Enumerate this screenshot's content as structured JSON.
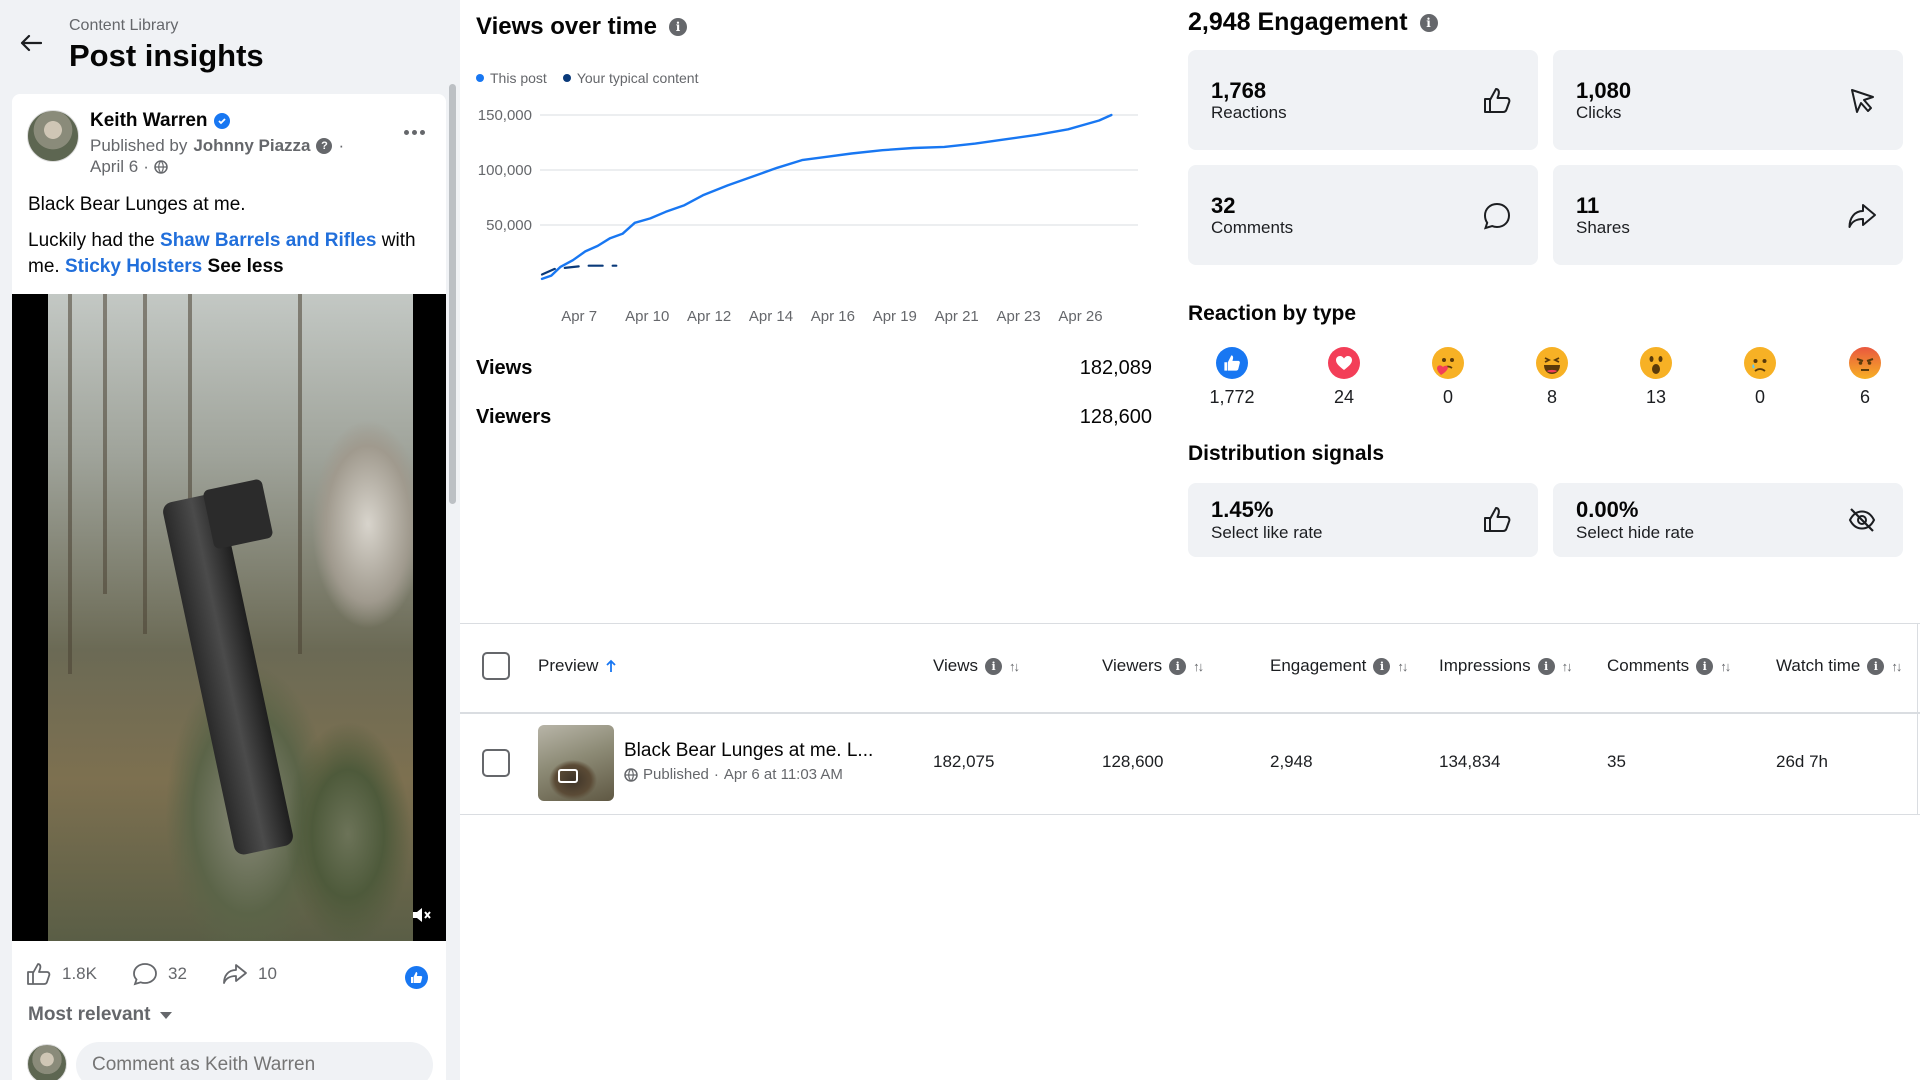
{
  "header": {
    "breadcrumb": "Content Library",
    "title": "Post insights"
  },
  "post": {
    "author": "Keith Warren",
    "published_by_prefix": "Published by",
    "publisher": "Johnny Piazza",
    "date": "April 6",
    "text_line1": "Black Bear Lunges at me.",
    "text_pre_link": "Luckily had the ",
    "link1": "Shaw Barrels and Rifles",
    "text_mid": " with me. ",
    "link2": "Sticky Holsters",
    "see_less": "See less",
    "likes": "1.8K",
    "comments": "32",
    "shares": "10",
    "sort_label": "Most relevant",
    "comment_placeholder": "Comment as Keith Warren"
  },
  "views_chart": {
    "title": "Views over time",
    "legend": {
      "this_post": "This post",
      "typical": "Your typical content"
    },
    "stats": [
      {
        "label": "Views",
        "value": "182,089"
      },
      {
        "label": "Viewers",
        "value": "128,600"
      }
    ]
  },
  "chart_data": {
    "type": "line",
    "title": "Views over time",
    "x_tick_labels": [
      "Apr 7",
      "Apr 10",
      "Apr 12",
      "Apr 14",
      "Apr 16",
      "Apr 19",
      "Apr 21",
      "Apr 23",
      "Apr 26"
    ],
    "y_tick_labels": [
      "150,000",
      "100,000",
      "50,000"
    ],
    "ylim": [
      0,
      150000
    ],
    "grid": true,
    "legend_position": "top-left",
    "series": [
      {
        "name": "This post",
        "color": "#1877f2",
        "x": [
          0,
          0.3,
          0.6,
          1.0,
          1.4,
          1.8,
          2.2,
          2.6,
          3.0,
          3.5,
          4.0,
          4.6,
          5.2,
          6.0,
          6.8,
          7.6,
          8.4,
          9.2,
          10.0,
          11.0,
          12.0,
          13.0,
          14.0,
          15.0,
          16.0,
          17.0,
          18.0,
          18.4
        ],
        "values": [
          1000,
          4000,
          12000,
          18000,
          26000,
          31000,
          38000,
          42000,
          52000,
          56000,
          62000,
          68000,
          77000,
          86000,
          94000,
          102000,
          109000,
          112000,
          115000,
          118000,
          120000,
          121000,
          124000,
          128000,
          132000,
          137000,
          145000,
          150000
        ]
      },
      {
        "name": "Your typical content",
        "color": "#0a3a7a",
        "dashed": true,
        "x": [
          0,
          0.4,
          1.4,
          2.4
        ],
        "values": [
          5000,
          10000,
          13000,
          13000
        ]
      }
    ]
  },
  "engagement": {
    "title": "2,948 Engagement",
    "tiles": [
      {
        "value": "1,768",
        "label": "Reactions",
        "icon": "thumbs-up-icon"
      },
      {
        "value": "1,080",
        "label": "Clicks",
        "icon": "cursor-icon"
      },
      {
        "value": "32",
        "label": "Comments",
        "icon": "comment-icon"
      },
      {
        "value": "11",
        "label": "Shares",
        "icon": "share-icon"
      }
    ]
  },
  "reactions": {
    "title": "Reaction by type",
    "items": [
      {
        "name": "like",
        "count": "1,772"
      },
      {
        "name": "love",
        "count": "24"
      },
      {
        "name": "care",
        "count": "0"
      },
      {
        "name": "haha",
        "count": "8"
      },
      {
        "name": "wow",
        "count": "13"
      },
      {
        "name": "sad",
        "count": "0"
      },
      {
        "name": "angry",
        "count": "6"
      }
    ]
  },
  "distribution": {
    "title": "Distribution signals",
    "tiles": [
      {
        "value": "1.45%",
        "label": "Select like rate",
        "icon": "thumbs-up-icon"
      },
      {
        "value": "0.00%",
        "label": "Select hide rate",
        "icon": "eye-off-icon"
      }
    ]
  },
  "table": {
    "headers": {
      "preview": "Preview",
      "views": "Views",
      "viewers": "Viewers",
      "engagement": "Engagement",
      "impressions": "Impressions",
      "comments": "Comments",
      "watch_time": "Watch time"
    },
    "rows": [
      {
        "title": "Black Bear Lunges at me. L...",
        "status": "Published",
        "date": "Apr 6 at 11:03 AM",
        "views": "182,075",
        "viewers": "128,600",
        "engagement": "2,948",
        "impressions": "134,834",
        "comments": "35",
        "watch_time": "26d 7h"
      }
    ]
  },
  "colors": {
    "accent": "#1877f2",
    "tile_bg": "#f0f2f5",
    "text_secondary": "#65676b"
  }
}
